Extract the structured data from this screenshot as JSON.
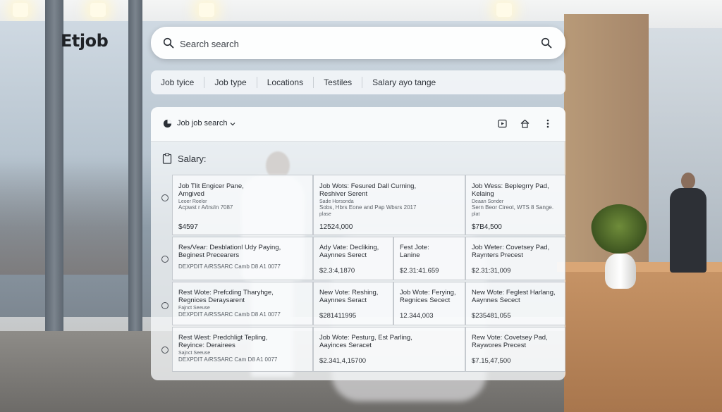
{
  "brand": "Etjob",
  "search": {
    "placeholder": "Search search"
  },
  "filters": [
    "Job tyice",
    "Job type",
    "Locations",
    "Testiles",
    "Salary ayo tange"
  ],
  "panel": {
    "title": "Job job search",
    "salary_label": "Salary:"
  },
  "rows": [
    {
      "cells": [
        {
          "l1": "Job Tlit Engicer Pane,",
          "l2": "Amgived",
          "l3": "Leoer Roelor",
          "l4": "Acpwst r A/trs/in 7087",
          "v": "$4597"
        },
        {
          "l1": "Job Wots: Fesured Dall Curning,",
          "l2": "Reshiver Serent",
          "l3": "Sade Horsonda",
          "l4": "Sobs, Hbrs Eone and Pap Wbsrs 2017",
          "l5": "plase",
          "v": "12524,000"
        },
        {
          "l1": "Job Wess: Beplegrry Pad,",
          "l2": "Kelaing",
          "l3": "Deaan Sonder",
          "l4": "Sern Beor Cireot, WTS 8 Sange.",
          "l5": "plat",
          "v": "$7B4,500"
        }
      ]
    },
    {
      "cells": [
        {
          "l1": "Res/Vear: Desblationl Udy Paying,",
          "l2": "Beginest Precearers",
          "l4": "DEXPDIT A/RSSARC Camb D8 A1 0077"
        },
        {
          "l1": "Ady Vate: Decliking,",
          "l2": "Aaynnes Serect",
          "v": "$2.3:4,1870"
        },
        {
          "l1": "Fest Jote:",
          "l2": "Lanine",
          "v": "$2.31:41.659"
        },
        {
          "l1": "Job Weter: Covetsey Pad,",
          "l2": "Raynters Precest",
          "v": "$2.31:31,009"
        }
      ]
    },
    {
      "cells": [
        {
          "l1": "Rest Wote: Prefcding Tharyhge,",
          "l2": "Regnices Deraysarent",
          "l3": "Fajnct Seeuse",
          "l4": "DEXPDIT A/RSSARC Camb D8 A1 0077"
        },
        {
          "l1": "New Vote: Reshing,",
          "l2": "Aaynnes Seract",
          "v": "$281411995"
        },
        {
          "l1": "Job Wote: Ferying,",
          "l2": "Regnices Secect",
          "v": "12.344,003"
        },
        {
          "l1": "New Wote: Feglest Harlang,",
          "l2": "Aaynnes Secect",
          "v": "$235481,055"
        }
      ]
    },
    {
      "cells": [
        {
          "l1": "Rest West: Predchligt Tepling,",
          "l2": "Reyince: Derairees",
          "l3": "Sajnct Seeuse",
          "l4": "DEXPDIT A/RSSARC Cam D8 A1 0077"
        },
        {
          "l1": "Job Wote: Pesturg, Est Parling,",
          "l2": "Aayinces Seracet",
          "v": "$2.341,4,15700"
        },
        {
          "l1": "Rew Vote: Covetsey Pad,",
          "l2": "Raywores Precest",
          "v": "$7.15,47,500"
        }
      ]
    }
  ],
  "icons": {
    "search_left": "search-icon",
    "search_right": "search-icon",
    "panel_left": "pie-icon",
    "actions": [
      "media-icon",
      "home-icon",
      "more-vertical-icon"
    ],
    "salary": "clipboard-icon"
  }
}
